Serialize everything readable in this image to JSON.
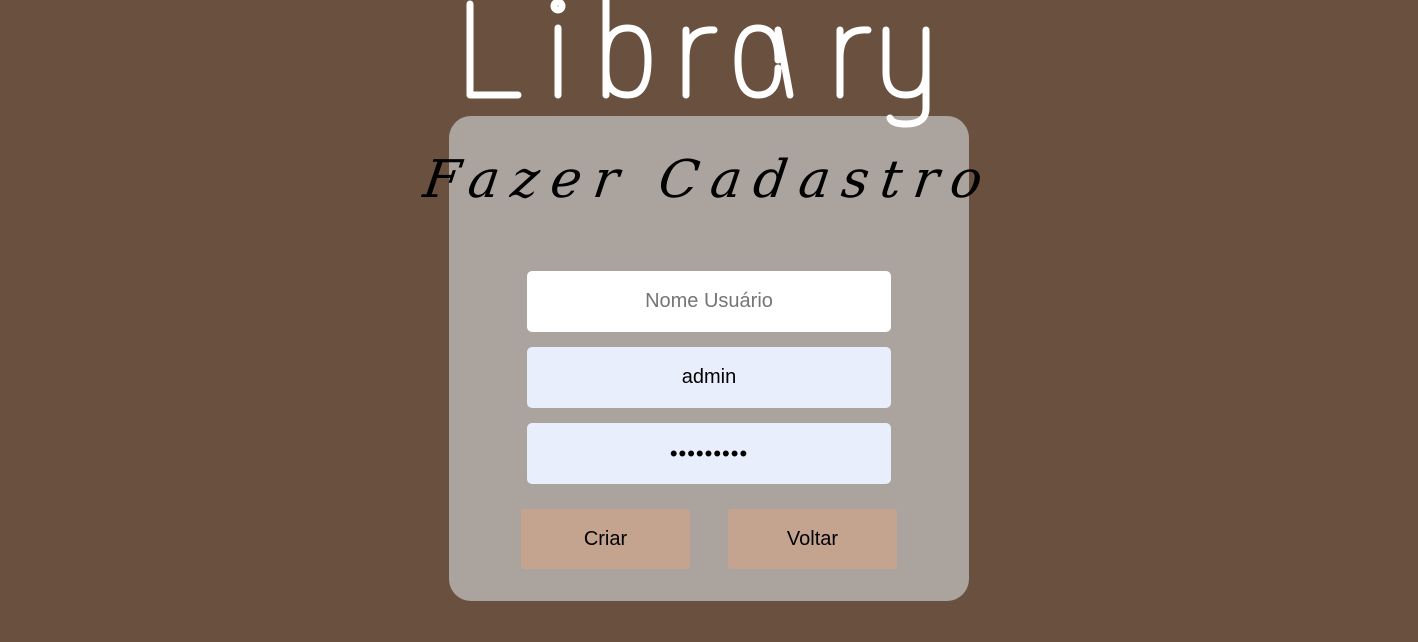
{
  "header": {
    "logo_text": "Library"
  },
  "form": {
    "title": "Fazer Cadastro",
    "username_placeholder": "Nome Usuário",
    "username_value": "",
    "email_value": "admin",
    "password_value": "•••••••••",
    "create_label": "Criar",
    "back_label": "Voltar"
  },
  "colors": {
    "background": "#69503f",
    "card": "#aba39e",
    "button": "#c4a48f",
    "autofill_field": "#e8eefb"
  }
}
